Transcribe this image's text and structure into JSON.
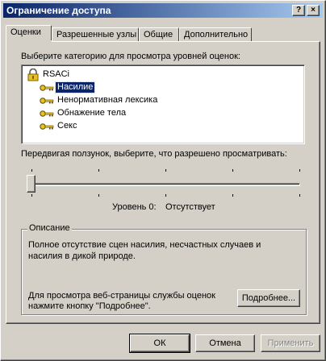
{
  "window": {
    "title": "Ограничение доступа",
    "help_label": "?",
    "close_label": "×"
  },
  "tabs": [
    {
      "label": "Оценки",
      "active": true
    },
    {
      "label": "Разрешенные узлы",
      "active": false
    },
    {
      "label": "Общие",
      "active": false
    },
    {
      "label": "Дополнительно",
      "active": false
    }
  ],
  "ratings": {
    "category_prompt": "Выберите категорию для просмотра уровней оценок:",
    "root": {
      "label": "RSACi",
      "icon": "lock-icon"
    },
    "categories": [
      {
        "label": "Насилие",
        "icon": "key-icon",
        "selected": true
      },
      {
        "label": "Ненормативная лексика",
        "icon": "key-icon",
        "selected": false
      },
      {
        "label": "Обнажение тела",
        "icon": "key-icon",
        "selected": false
      },
      {
        "label": "Секс",
        "icon": "key-icon",
        "selected": false
      }
    ],
    "slider_prompt": "Передвигая ползунок, выберите, что разрешено просматривать:",
    "slider": {
      "value": 0,
      "min": 0,
      "max": 4
    },
    "level_label": "Уровень 0:",
    "level_value": "Отсутствует"
  },
  "description": {
    "caption": "Описание",
    "text": "Полное отсутствие сцен насилия, несчастных случаев и насилия в дикой природе.",
    "more_info_text": "Для просмотра веб-страницы службы оценок нажмите кнопку \"Подробнее\".",
    "more_button": "Подробнее..."
  },
  "buttons": {
    "ok": "ОК",
    "cancel": "Отмена",
    "apply": "Применить"
  }
}
